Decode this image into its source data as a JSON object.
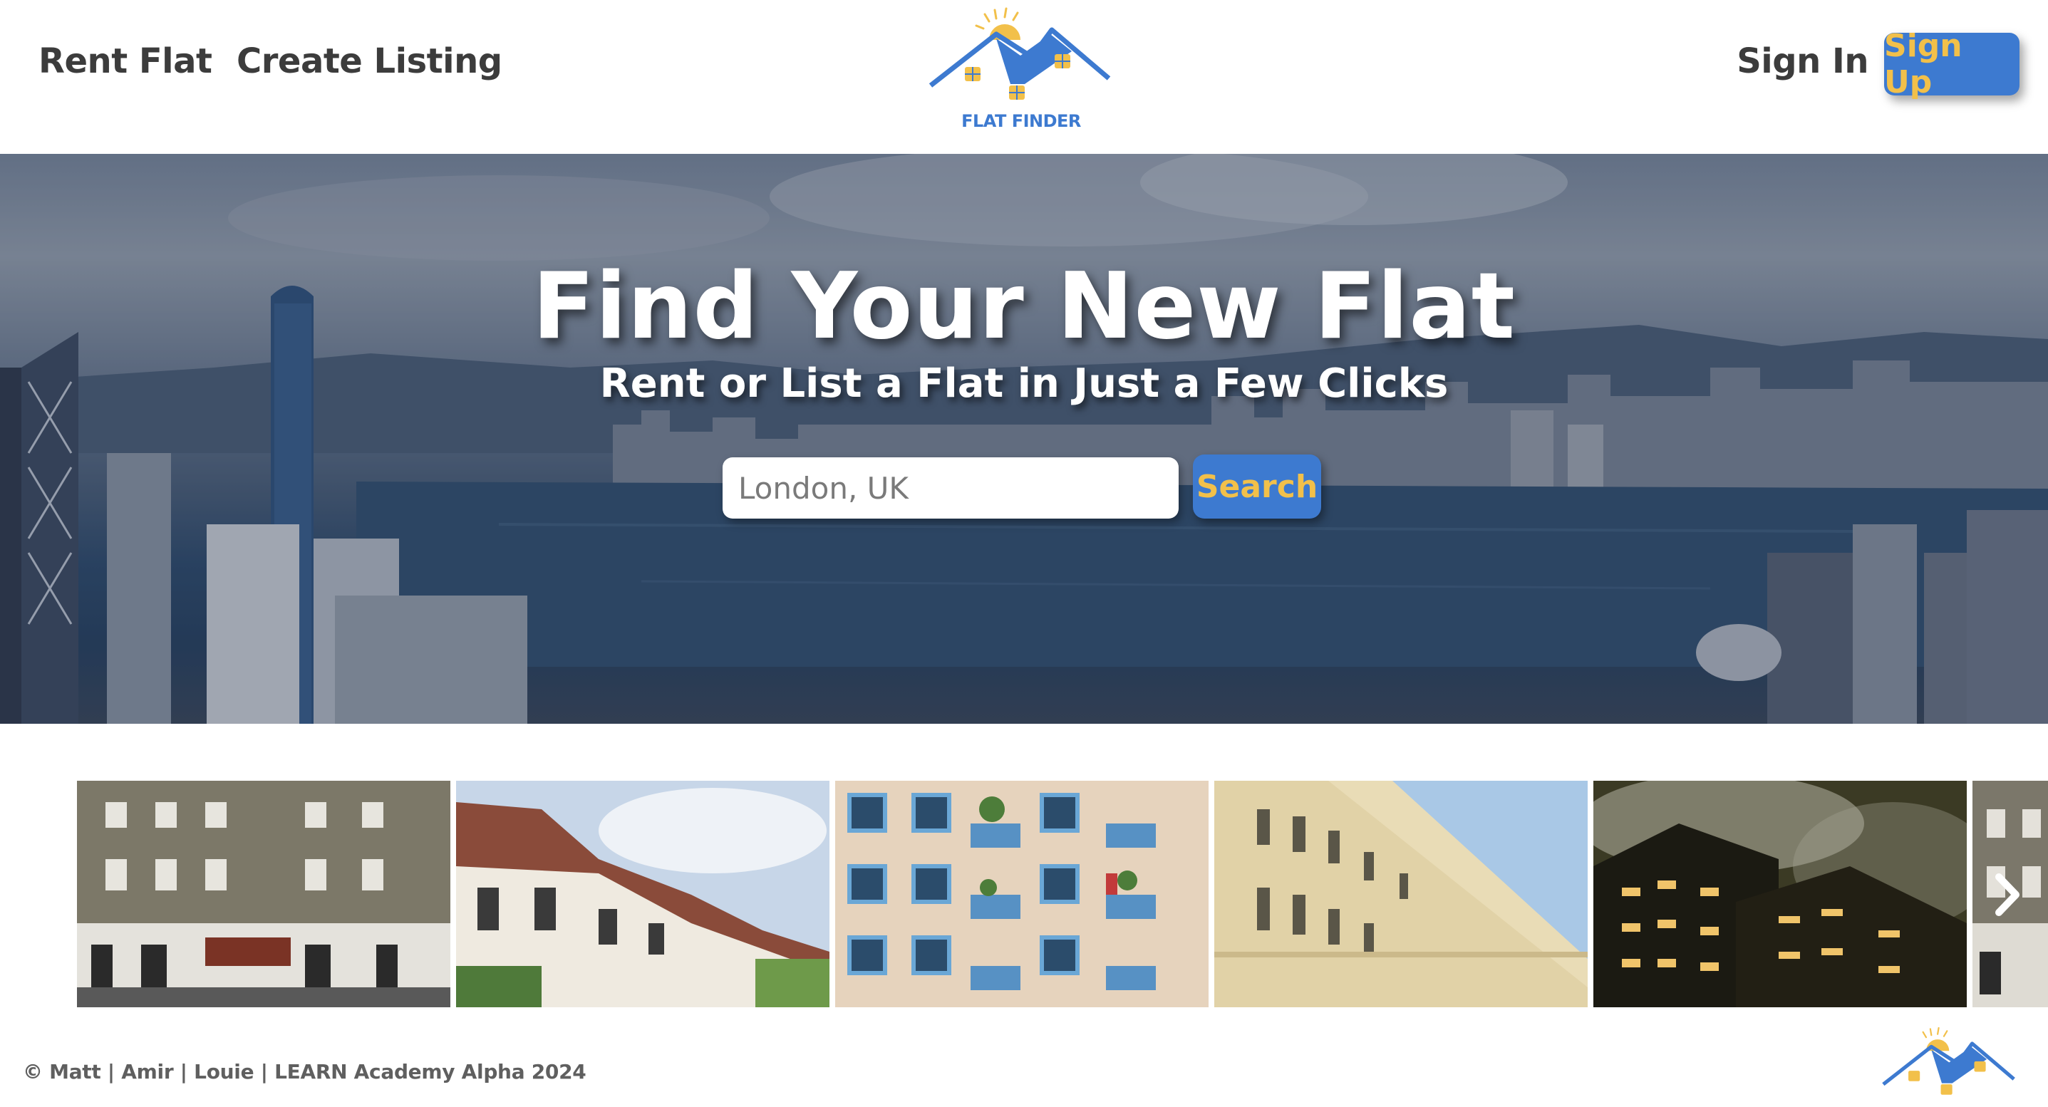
{
  "header": {
    "nav": {
      "rent_flat": "Rent Flat",
      "create_listing": "Create Listing"
    },
    "logo_text": "FLAT FINDER",
    "auth": {
      "sign_in": "Sign In",
      "sign_up": "Sign Up"
    }
  },
  "hero": {
    "title": "Find Your New Flat",
    "subtitle": "Rent or List a Flat in Just a Few Clicks",
    "search": {
      "placeholder": "London, UK",
      "button_label": "Search"
    }
  },
  "carousel": {
    "tiles": [
      "brick-townhouse-photo",
      "terraced-houses-photo",
      "balcony-apartments-photo",
      "cream-terrace-photo",
      "night-apartment-block-photo",
      "partial-townhouse-photo"
    ],
    "next_icon": "chevron-right-icon"
  },
  "footer": {
    "credits": "© Matt | Amir | Louie | LEARN Academy Alpha 2024"
  },
  "colors": {
    "brand_blue": "#3d7ad0",
    "brand_yellow": "#f2c04a",
    "nav_text": "#3c3c3c"
  }
}
